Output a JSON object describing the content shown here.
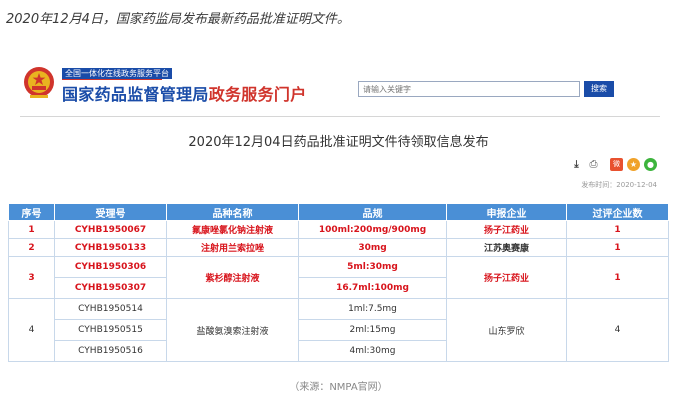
{
  "intro": "2020年12月4日，国家药监局发布最新药品批准证明文件。",
  "header": {
    "top_tag": "全国一体化在线政务服务平台",
    "brand_main": "国家药品监督管理局",
    "brand_accent": "政务服务门户",
    "search_placeholder": "请输入关键字",
    "search_button": "搜索"
  },
  "page_title": "2020年12月04日药品批准证明文件待领取信息发布",
  "tools": {
    "weibo": "微"
  },
  "pub_date": "发布时间：2020-12-04",
  "colors": {
    "brand_blue": "#1a4ca8",
    "brand_red": "#d0342c",
    "table_header": "#4a8fd6",
    "highlight_red": "#d8141c"
  },
  "table": {
    "headers": [
      "序号",
      "受理号",
      "品种名称",
      "品规",
      "申报企业",
      "过评企业数"
    ],
    "groups": [
      {
        "no": "1",
        "name": "氟康唑氯化钠注射液",
        "company": "扬子江药业",
        "count": "1",
        "items": [
          {
            "accept": "CYHB1950067",
            "spec": "100ml:200mg/900mg"
          }
        ]
      },
      {
        "no": "2",
        "name": "注射用兰索拉唑",
        "company": "江苏奥赛康",
        "count": "1",
        "items": [
          {
            "accept": "CYHB1950133",
            "spec": "30mg"
          }
        ]
      },
      {
        "no": "3",
        "name": "紫杉醇注射液",
        "company": "扬子江药业",
        "count": "1",
        "items": [
          {
            "accept": "CYHB1950306",
            "spec": "5ml:30mg"
          },
          {
            "accept": "CYHB1950307",
            "spec": "16.7ml:100mg"
          }
        ]
      },
      {
        "no": "4",
        "name": "盐酸氨溴索注射液",
        "company": "山东罗欣",
        "count": "4",
        "items": [
          {
            "accept": "CYHB1950514",
            "spec": "1ml:7.5mg"
          },
          {
            "accept": "CYHB1950515",
            "spec": "2ml:15mg"
          },
          {
            "accept": "CYHB1950516",
            "spec": "4ml:30mg"
          }
        ]
      }
    ]
  },
  "source": "（来源：NMPA官网）"
}
